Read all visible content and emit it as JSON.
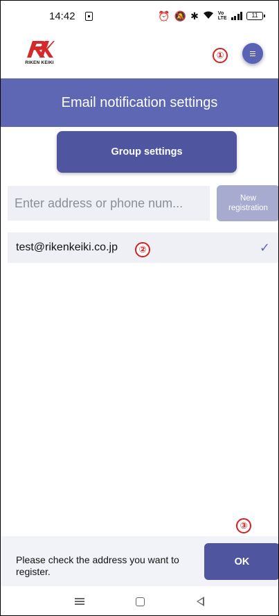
{
  "status_bar": {
    "time": "14:42",
    "battery": "11",
    "icons": [
      "sim-icon",
      "alarm-icon",
      "mute-icon",
      "bluetooth-icon",
      "wifi-icon",
      "volte-icon",
      "signal-icon",
      "battery-icon"
    ]
  },
  "header": {
    "logo_text": "RIKEN KEIKI",
    "menu_icon": "menu-icon"
  },
  "annotations": {
    "one": "①",
    "two": "②",
    "three": "③"
  },
  "title": "Email notification settings",
  "group_settings_label": "Group settings",
  "address_input": {
    "placeholder": "Enter address or phone num...",
    "value": ""
  },
  "new_registration": {
    "line1": "New",
    "line2": "registration"
  },
  "addresses": [
    {
      "address": "test@rikenkeiki.co.jp",
      "checked": true
    }
  ],
  "bottom": {
    "message": "Please check the address you want to register.",
    "ok_label": "OK"
  },
  "nav": {
    "icons": [
      "recent-apps-icon",
      "home-icon",
      "back-icon"
    ]
  },
  "colors": {
    "primary": "#5d67b3",
    "button": "#4f559f",
    "button_disabled": "#a6abcf",
    "annotation": "#d61f1f",
    "logo_red": "#d42a2a"
  }
}
